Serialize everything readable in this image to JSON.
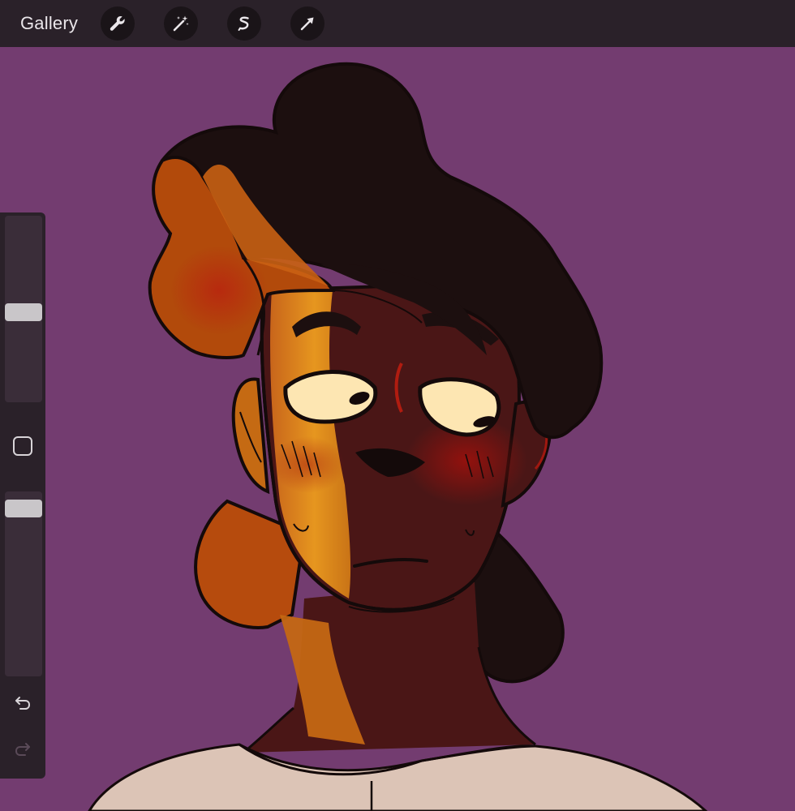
{
  "topbar": {
    "gallery_label": "Gallery",
    "tools": [
      {
        "icon": "wrench-icon"
      },
      {
        "icon": "magic-wand-icon"
      },
      {
        "icon": "selection-s-icon"
      },
      {
        "icon": "transform-arrow-icon"
      }
    ]
  },
  "sidebar": {
    "brush_size_level": 0.48,
    "opacity_level": 0.05,
    "modify_button_icon": "square-icon",
    "undo_icon": "undo-icon",
    "redo_icon": "redo-icon"
  },
  "colors": {
    "background": "#733c70",
    "toolbar": "#2a2129",
    "hair": "#1c0f0f",
    "skin_shadow": "#4a1616",
    "skin_light": "#e0901e",
    "eyes": "#fde6b2",
    "shirt": "#dcc4b6"
  }
}
